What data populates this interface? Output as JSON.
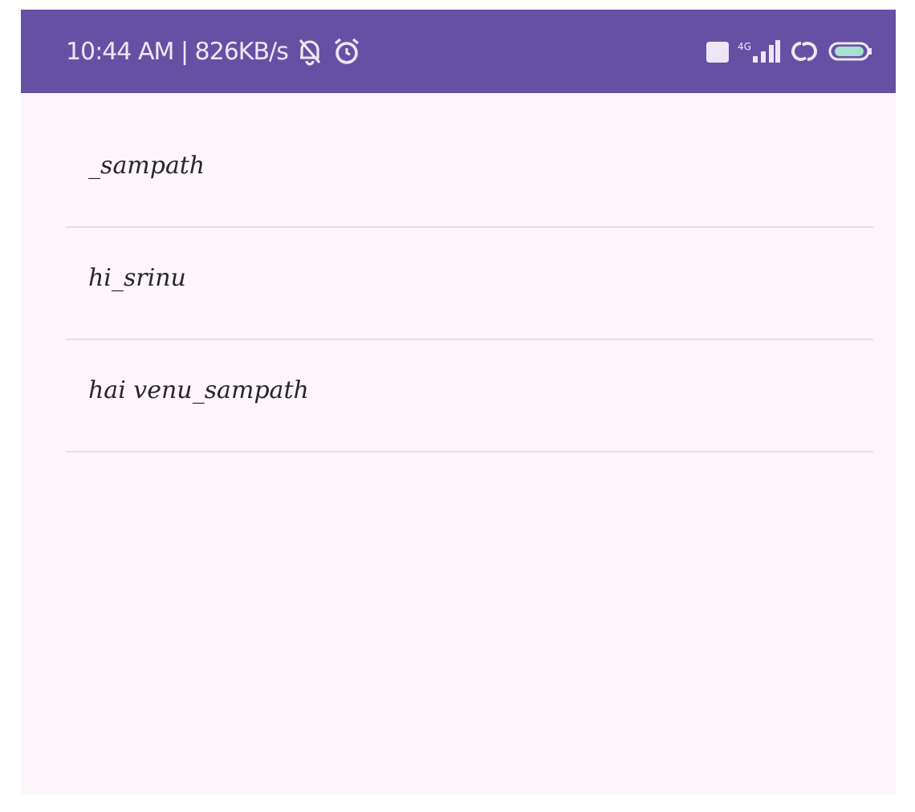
{
  "status_bar": {
    "time": "10:44 AM | 826KB/s",
    "network_type": "4G"
  },
  "list": {
    "items": [
      {
        "text": "_sampath"
      },
      {
        "text": "hi_srinu"
      },
      {
        "text": "hai venu_sampath"
      }
    ]
  }
}
